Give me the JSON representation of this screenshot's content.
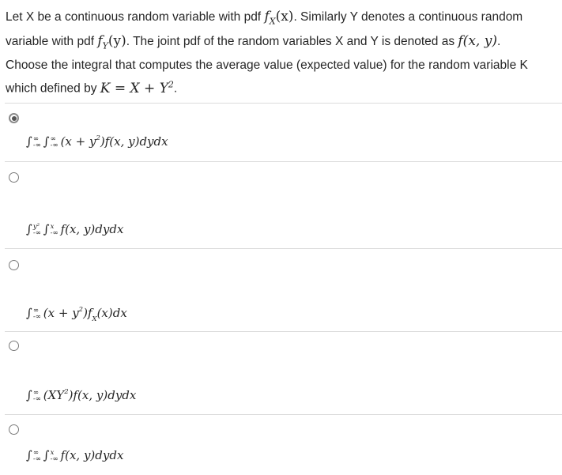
{
  "question": {
    "line1_a": "Let X be a continuous random variable with pdf ",
    "line1_math1": "f",
    "line1_math1_sub": "X",
    "line1_math1_arg": "(x)",
    "line1_b": ". Similarly Y denotes a continuous random",
    "line2_a": "variable with pdf ",
    "line2_math1": "f",
    "line2_math1_sub": "Y",
    "line2_math1_arg": "(y)",
    "line2_b": ". The joint pdf of the random variables X and Y is denoted as ",
    "line2_math2": "f(x, y)",
    "line2_c": ".",
    "line3": "Choose the integral that computes the average value (expected value) for the random variable K",
    "line4_a": "which defined by ",
    "line4_math": "K = X + Y",
    "line4_math_sup": "2",
    "line4_c": "."
  },
  "options": [
    {
      "selected": true,
      "int1_upper": "∞",
      "int1_lower": "-∞",
      "int2_upper": "∞",
      "int2_lower": "-∞",
      "body": "(x + y",
      "body_sup": "2",
      "body_tail": ")f(x, y)dydx"
    },
    {
      "selected": false,
      "int1_upper": "y²",
      "int1_lower": "-∞",
      "int2_upper": "x",
      "int2_lower": "-∞",
      "body": "f(x, y)dydx"
    },
    {
      "selected": false,
      "int1_upper": "∞",
      "int1_lower": "-∞",
      "body": "(x + y",
      "body_sup": "2",
      "body_tail": ")f",
      "body_sub": "X",
      "body_tail2": "(x)dx"
    },
    {
      "selected": false,
      "int1_upper": "∞",
      "int1_lower": "-∞",
      "body": "(XY",
      "body_sup": "2",
      "body_tail": ")f(x, y)dydx"
    },
    {
      "selected": false,
      "int1_upper": "∞",
      "int1_lower": "-∞",
      "int2_upper": "x",
      "int2_lower": "-∞",
      "body": "f(x, y)dydx"
    }
  ]
}
